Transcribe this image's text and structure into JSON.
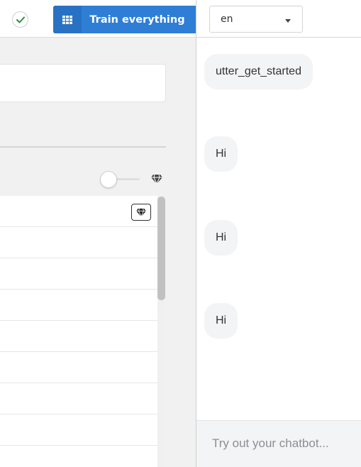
{
  "toolbar": {
    "train_label": "Train everything",
    "status_icon": "check-icon",
    "train_icon": "grid-icon"
  },
  "language": {
    "selected": "en"
  },
  "chat": {
    "messages": [
      "utter_get_started",
      "Hi",
      "Hi",
      "Hi"
    ],
    "input_placeholder": "Try out your chatbot..."
  },
  "colors": {
    "accent": "#2e7ed6",
    "accent_dark": "#2872c3",
    "check": "#2e8b3e",
    "bubble_bg": "#f2f4f6"
  }
}
